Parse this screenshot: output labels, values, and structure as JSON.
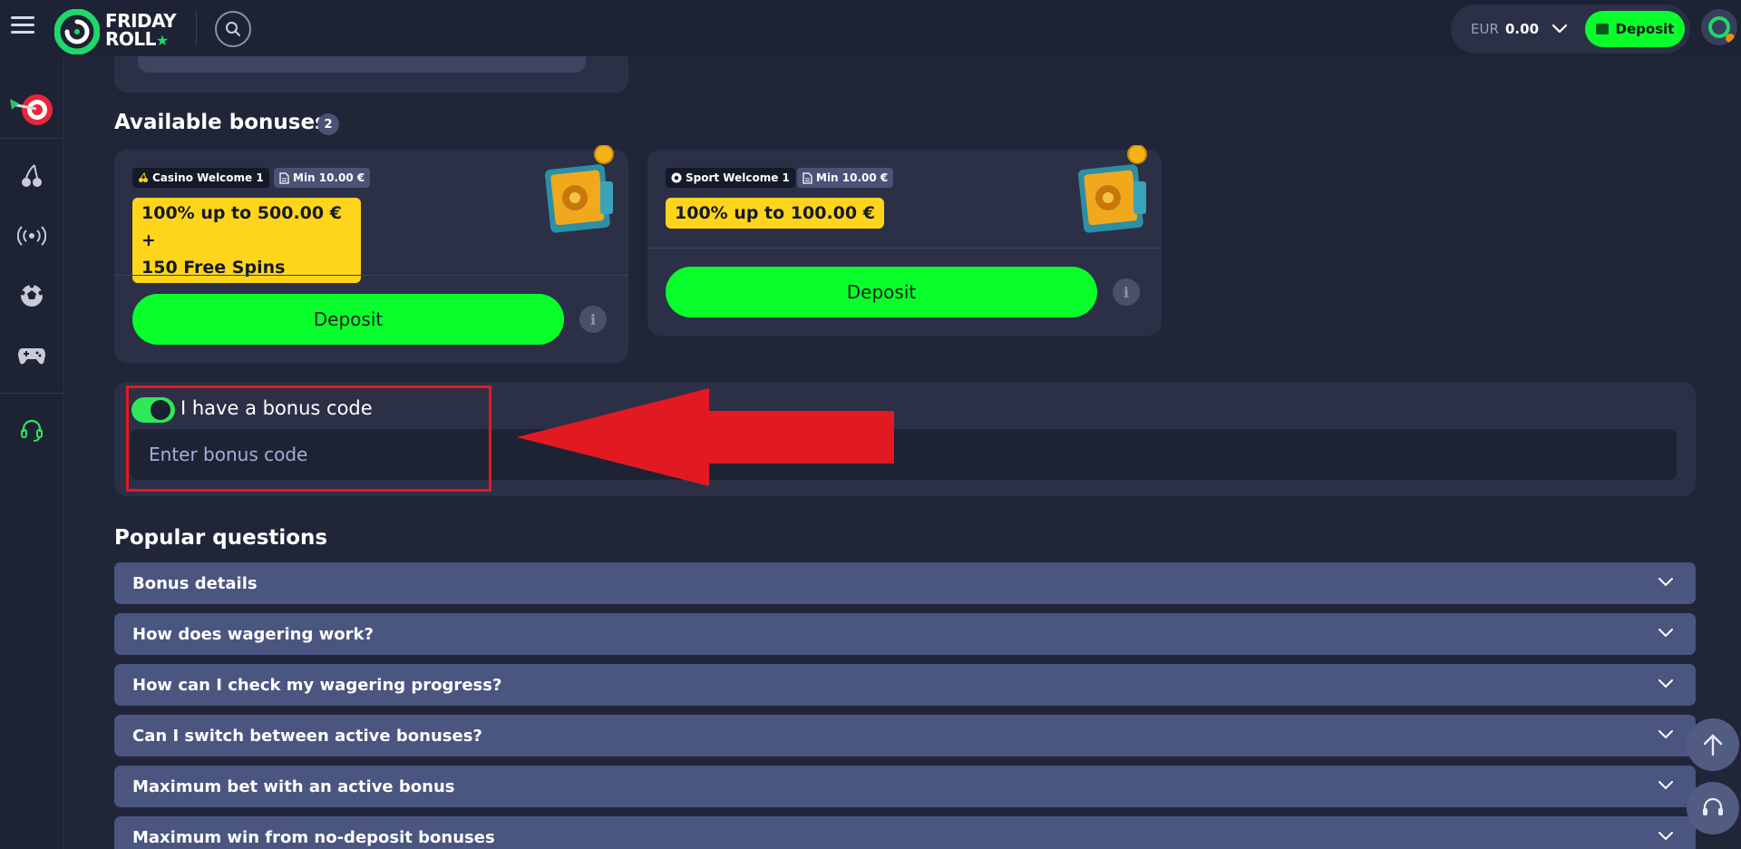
{
  "header": {
    "logo": {
      "line1": "FRIDAY",
      "line2": "ROLL",
      "star": "★"
    },
    "balance": {
      "currency": "EUR",
      "amount": "0.00"
    },
    "deposit_label": "Deposit"
  },
  "rail": {
    "items": [
      {
        "name": "darts-target-icon"
      },
      {
        "name": "cherries-icon"
      },
      {
        "name": "live-broadcast-icon"
      },
      {
        "name": "soccer-ball-icon"
      },
      {
        "name": "gamepad-icon"
      },
      {
        "name": "headset-support-icon"
      }
    ]
  },
  "bonuses": {
    "title": "Available bonuses",
    "count": "2",
    "cards": [
      {
        "tag": "Casino Welcome 1",
        "min": "Min 10.00 €",
        "headline_line1": "100% up to 500.00 € +",
        "headline_line2": "150 Free Spins",
        "deposit_label": "Deposit",
        "info": "i"
      },
      {
        "tag": "Sport Welcome 1",
        "min": "Min 10.00 €",
        "headline_line1": "100% up to 100.00 €",
        "deposit_label": "Deposit",
        "info": "i"
      }
    ]
  },
  "bonus_code": {
    "toggle_label": "I have a bonus code",
    "toggle_on": true,
    "placeholder": "Enter bonus code"
  },
  "faq": {
    "title": "Popular questions",
    "items": [
      "Bonus details",
      "How does wagering work?",
      "How can I check my wagering progress?",
      "Can I switch between active bonuses?",
      "Maximum bet with an active bonus",
      "Maximum win from no-deposit bonuses"
    ]
  },
  "colors": {
    "background": "#202538",
    "card": "#2b3047",
    "accent_green": "#09ff2b",
    "highlight_yellow": "#ffd51c",
    "annotation_red": "#e11a22",
    "faq_row": "#4a5580"
  }
}
